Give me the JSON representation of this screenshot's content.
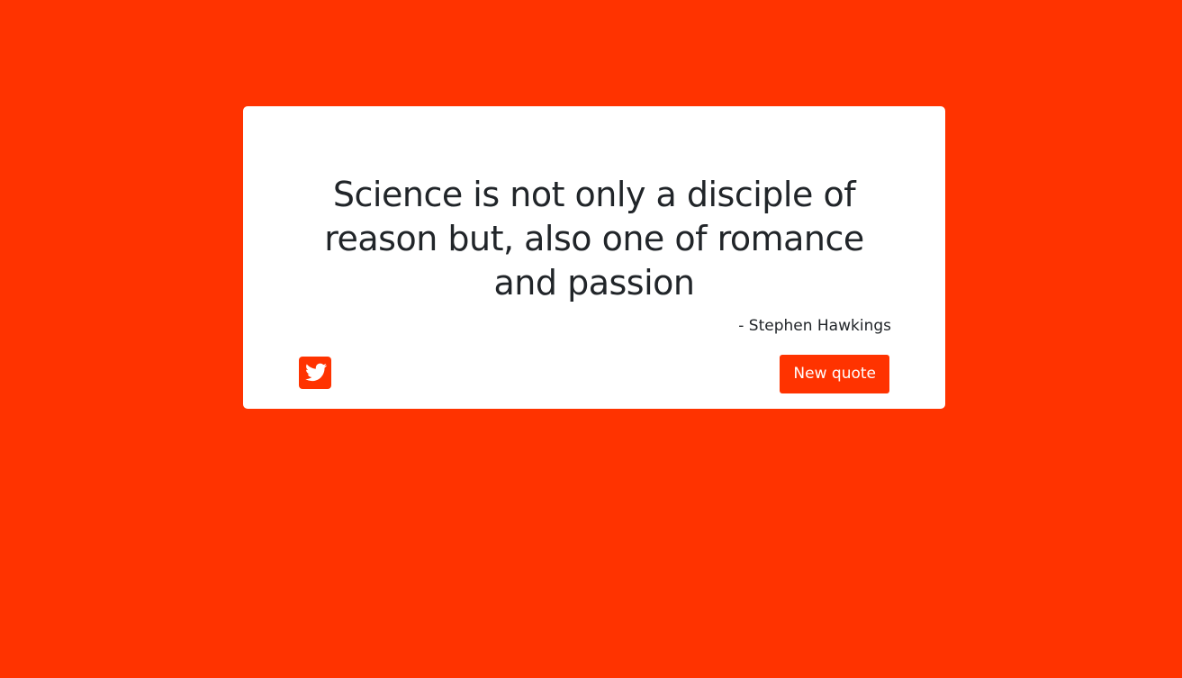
{
  "colors": {
    "background": "#ff3300",
    "card": "#ffffff",
    "text": "#212529",
    "accent": "#ff3300",
    "button_text": "#ffffff"
  },
  "quote": {
    "text": "Science is not only a disciple of reason but, also one of romance and passion",
    "author": "- Stephen Hawkings"
  },
  "actions": {
    "tweet_icon": "twitter-square-icon",
    "new_quote_label": "New quote"
  }
}
